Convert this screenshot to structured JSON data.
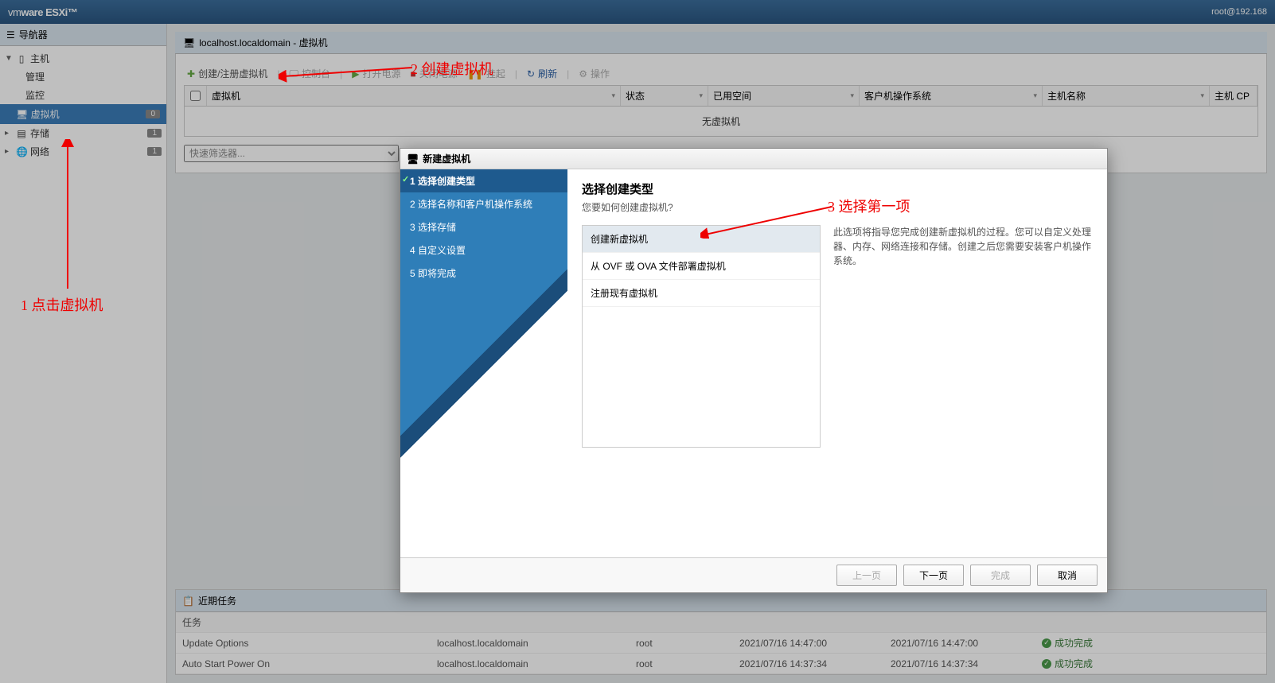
{
  "brand": {
    "vm": "vm",
    "ware": "ware",
    "product": "ESXi",
    "reg": "®"
  },
  "topbar": {
    "user": "root@192.168"
  },
  "sidebar": {
    "header": "导航器",
    "host": "主机",
    "host_children": [
      "管理",
      "监控"
    ],
    "vm": "虚拟机",
    "vm_count": "0",
    "storage": "存储",
    "storage_count": "1",
    "network": "网络",
    "network_count": "1"
  },
  "content": {
    "breadcrumb": "localhost.localdomain - 虚拟机",
    "toolbar": {
      "create": "创建/注册虚拟机",
      "console": "控制台",
      "poweron": "打开电源",
      "poweroff": "关闭电源",
      "suspend": "挂起",
      "refresh": "刷新",
      "actions": "操作"
    },
    "grid": {
      "col_vm": "虚拟机",
      "col_status": "状态",
      "col_space": "已用空间",
      "col_guestos": "客户机操作系统",
      "col_host": "主机名称",
      "col_hostcpu": "主机 CP",
      "empty": "无虚拟机"
    },
    "filter_placeholder": "快速筛选器..."
  },
  "tasks": {
    "header": "近期任务",
    "col_task": "任务",
    "rows": [
      {
        "task": "Update Options",
        "target": "localhost.localdomain",
        "initiator": "root",
        "queued": "2021/07/16 14:47:00",
        "started": "2021/07/16 14:47:00",
        "status": "成功完成"
      },
      {
        "task": "Auto Start Power On",
        "target": "localhost.localdomain",
        "initiator": "root",
        "queued": "2021/07/16 14:37:34",
        "started": "2021/07/16 14:37:34",
        "status": "成功完成"
      }
    ]
  },
  "dialog": {
    "title": "新建虚拟机",
    "steps": [
      "1 选择创建类型",
      "2 选择名称和客户机操作系统",
      "3 选择存储",
      "4 自定义设置",
      "5 即将完成"
    ],
    "heading": "选择创建类型",
    "subheading": "您要如何创建虚拟机?",
    "options": [
      "创建新虚拟机",
      "从 OVF 或 OVA 文件部署虚拟机",
      "注册现有虚拟机"
    ],
    "description": "此选项将指导您完成创建新虚拟机的过程。您可以自定义处理器、内存、网络连接和存储。创建之后您需要安装客户机操作系统。",
    "btn_back": "上一页",
    "btn_next": "下一页",
    "btn_finish": "完成",
    "btn_cancel": "取消"
  },
  "annotations": {
    "a1": "1    点击虚拟机",
    "a2": "2    创建虚拟机",
    "a3": "3    选择第一项"
  }
}
